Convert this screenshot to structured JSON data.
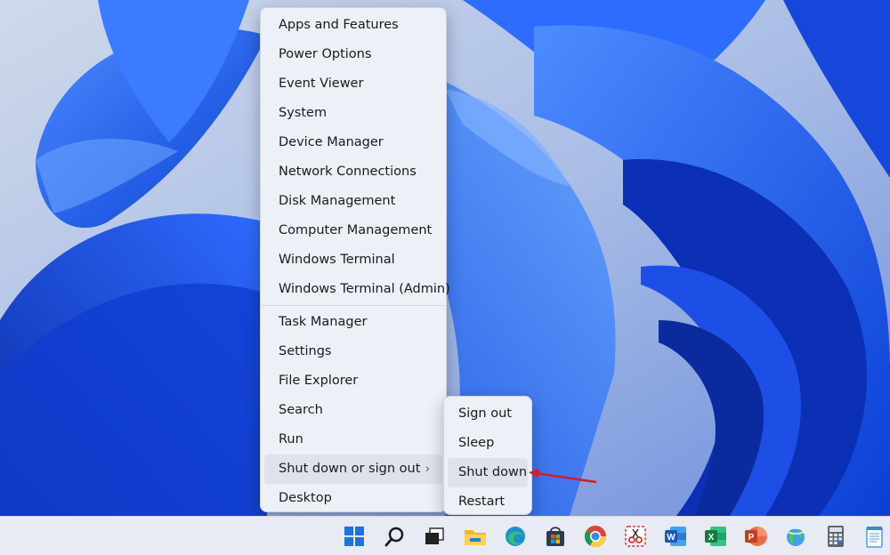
{
  "context_menu": {
    "group1": [
      "Apps and Features",
      "Power Options",
      "Event Viewer",
      "System",
      "Device Manager",
      "Network Connections",
      "Disk Management",
      "Computer Management",
      "Windows Terminal",
      "Windows Terminal (Admin)"
    ],
    "group2": [
      "Task Manager",
      "Settings",
      "File Explorer",
      "Search",
      "Run"
    ],
    "shutdown_item": "Shut down or sign out",
    "desktop_item": "Desktop"
  },
  "power_submenu": {
    "items": [
      "Sign out",
      "Sleep",
      "Shut down",
      "Restart"
    ]
  },
  "taskbar": {
    "icons": [
      "windows-start-icon",
      "search-icon",
      "task-view-icon",
      "file-explorer-icon",
      "edge-icon",
      "microsoft-store-icon",
      "chrome-icon",
      "snipping-tool-icon",
      "word-icon",
      "excel-icon",
      "powerpoint-icon",
      "globe-app-icon",
      "calculator-icon",
      "notepad-icon"
    ]
  },
  "colors": {
    "wallpaper_blue": "#1c55e8",
    "menu_background": "#eef0f8",
    "annotation_arrow": "#e01919"
  }
}
